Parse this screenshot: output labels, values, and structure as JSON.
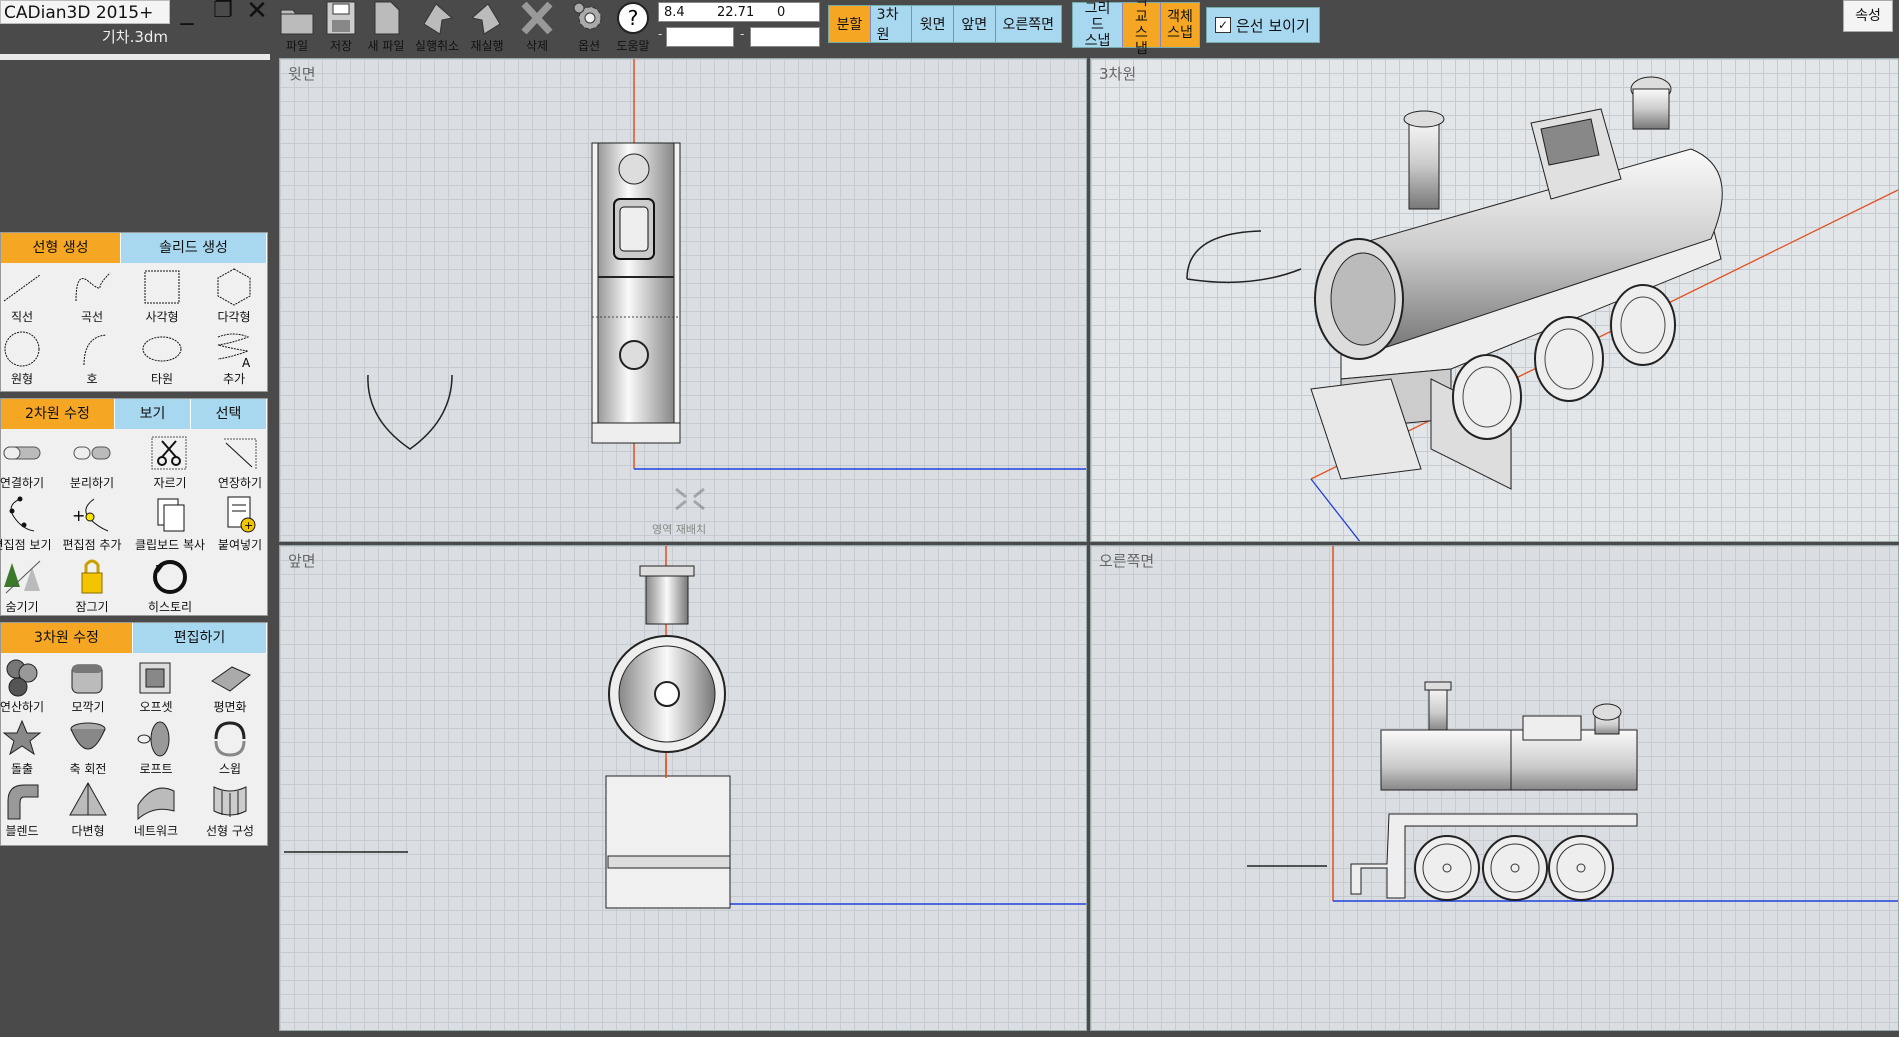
{
  "window": {
    "app_title": "CADian3D 2015+",
    "file_name": "기차.3dm",
    "minimize": "_",
    "restore": "❐",
    "close": "✕"
  },
  "toolbar": {
    "buttons": [
      {
        "label": "파일",
        "icon": "folder-icon"
      },
      {
        "label": "저장",
        "icon": "save-icon"
      },
      {
        "label": "새 파일",
        "icon": "new-file-icon"
      },
      {
        "label": "실행취소",
        "icon": "undo-icon"
      },
      {
        "label": "재실행",
        "icon": "redo-icon"
      },
      {
        "label": "삭제",
        "icon": "delete-icon"
      },
      {
        "label": "옵션",
        "icon": "gear-icon"
      },
      {
        "label": "도움말",
        "icon": "help-icon"
      }
    ],
    "coords": {
      "x": "8.4",
      "y": "22.71",
      "z": "0"
    },
    "coord_dash_1": "-",
    "coord_dash_2": "-",
    "view_buttons": [
      {
        "label": "분할",
        "active": true
      },
      {
        "label": "3차원",
        "active": false
      },
      {
        "label": "윗면",
        "active": false
      },
      {
        "label": "앞면",
        "active": false
      },
      {
        "label": "오른쪽면",
        "active": false
      }
    ],
    "snap_buttons": [
      {
        "line1": "그리드",
        "line2": "스냅",
        "active": false
      },
      {
        "line1": "직교",
        "line2": "스냅",
        "active": true
      },
      {
        "line1": "객체",
        "line2": "스냅",
        "active": true
      }
    ],
    "hidden_lines": {
      "label": "은선 보이기",
      "checked": true,
      "check_glyph": "✓"
    },
    "properties": "속성"
  },
  "panels": {
    "create": {
      "tabs": [
        "선형 생성",
        "솔리드 생성"
      ],
      "tools": [
        {
          "label": "직선",
          "icon": "line-icon"
        },
        {
          "label": "곡선",
          "icon": "curve-icon"
        },
        {
          "label": "사각형",
          "icon": "rectangle-icon"
        },
        {
          "label": "다각형",
          "icon": "polygon-icon"
        },
        {
          "label": "원형",
          "icon": "circle-icon"
        },
        {
          "label": "호",
          "icon": "arc-icon"
        },
        {
          "label": "타원",
          "icon": "ellipse-icon"
        },
        {
          "label": "추가",
          "icon": "more-icon"
        }
      ]
    },
    "edit2d": {
      "tabs": [
        "2차원 수정",
        "보기",
        "선택"
      ],
      "tools": [
        {
          "label": "연결하기",
          "icon": "join-icon"
        },
        {
          "label": "분리하기",
          "icon": "explode-icon"
        },
        {
          "label": "자르기",
          "icon": "trim-icon"
        },
        {
          "label": "연장하기",
          "icon": "extend-icon"
        },
        {
          "label": "편집점 보기",
          "icon": "show-points-icon"
        },
        {
          "label": "편집점 추가",
          "icon": "add-point-icon"
        },
        {
          "label": "클립보드 복사",
          "icon": "copy-icon"
        },
        {
          "label": "붙여넣기",
          "icon": "paste-icon"
        },
        {
          "label": "숨기기",
          "icon": "hide-icon"
        },
        {
          "label": "잠그기",
          "icon": "lock-icon"
        },
        {
          "label": "히스토리",
          "icon": "history-icon"
        }
      ]
    },
    "edit3d": {
      "tabs": [
        "3차원 수정",
        "편집하기"
      ],
      "tools": [
        {
          "label": "연산하기",
          "icon": "boolean-icon"
        },
        {
          "label": "모깍기",
          "icon": "fillet-icon"
        },
        {
          "label": "오프셋",
          "icon": "offset-icon"
        },
        {
          "label": "평면화",
          "icon": "flatten-icon"
        },
        {
          "label": "돌출",
          "icon": "extrude-icon"
        },
        {
          "label": "축 회전",
          "icon": "revolve-icon"
        },
        {
          "label": "로프트",
          "icon": "loft-icon"
        },
        {
          "label": "스윕",
          "icon": "sweep-icon"
        },
        {
          "label": "블렌드",
          "icon": "blend-icon"
        },
        {
          "label": "다변형",
          "icon": "polyhedron-icon"
        },
        {
          "label": "네트워크",
          "icon": "network-icon"
        },
        {
          "label": "선형 구성",
          "icon": "line-construct-icon"
        }
      ]
    }
  },
  "viewports": [
    {
      "title": "윗면",
      "reset_label": "영역 재배치"
    },
    {
      "title": "3차원"
    },
    {
      "title": "앞면"
    },
    {
      "title": "오른쪽면"
    }
  ],
  "colors": {
    "accent_orange": "#f5a623",
    "accent_blue": "#a8d8f0",
    "axis_x": "#e05020",
    "axis_y": "#2040e0",
    "viewport_bg": "#dadee2"
  }
}
